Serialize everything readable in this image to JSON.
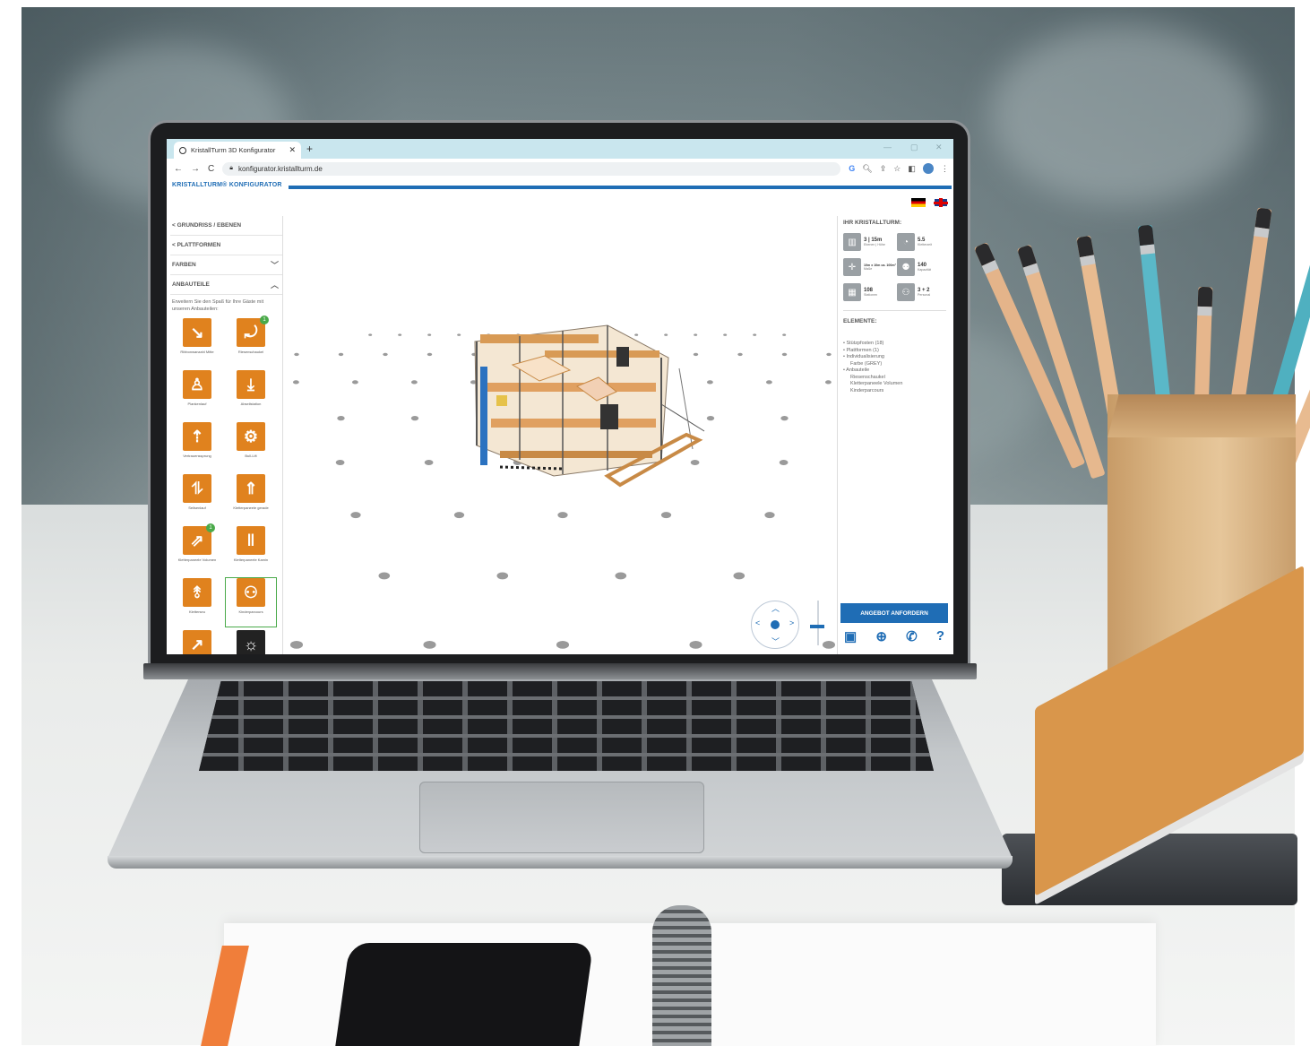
{
  "browser": {
    "tab_title": "KristallTurm 3D Konfigurator",
    "url": "konfigurator.kristallturm.de"
  },
  "app": {
    "brand": "KRISTALLTURM® KONFIGURATOR"
  },
  "sidebar": {
    "items": [
      {
        "label": "< GRUNDRISS / EBENEN"
      },
      {
        "label": "< PLATTFORMEN"
      },
      {
        "label": "FARBEN",
        "state": "collapsed"
      },
      {
        "label": "ANBAUTEILE",
        "state": "expanded"
      }
    ],
    "description": "Erweitern Sie den Spaß für Ihre Gäste mit unseren Anbauteilen:",
    "tiles": [
      {
        "label": "Ribbonwanzahl Mitte",
        "icon": "slide-figure-icon"
      },
      {
        "label": "Riesenschaukel",
        "icon": "swing-figure-icon",
        "badge": "1"
      },
      {
        "label": "Plankenlauf",
        "icon": "plank-walk-figure-icon"
      },
      {
        "label": "Abseilstation",
        "icon": "rappel-figure-icon"
      },
      {
        "label": "Vertrauenssprung",
        "icon": "trust-jump-figure-icon"
      },
      {
        "label": "Bull-Lift",
        "icon": "bike-figure-icon"
      },
      {
        "label": "Seilsenlauf",
        "icon": "rope-walk-figure-icon"
      },
      {
        "label": "Kletterpaneele gerade",
        "icon": "climbing-panel-icon"
      },
      {
        "label": "Kletterpaneele Volumen",
        "icon": "climbing-volume-icon",
        "badge": "1"
      },
      {
        "label": "Kletterpaneele Kamin",
        "icon": "climbing-chimney-icon"
      },
      {
        "label": "Kletterseu",
        "icon": "climbing-rope-icon"
      },
      {
        "label": "Kinderparcours",
        "icon": "kids-course-icon",
        "selected": true
      },
      {
        "label": "",
        "icon": "zipline-figure-icon"
      },
      {
        "label": "",
        "icon": "lightbulb-icon"
      }
    ]
  },
  "panel": {
    "title": "IHR KRISTALLTURM:",
    "stats": [
      {
        "value": "3 | 15m",
        "caption": "Ebenen | Höhe",
        "icon": "tower-levels-icon"
      },
      {
        "value": "5.5",
        "caption": "Kletterzeit",
        "icon": "clock-icon"
      },
      {
        "value": "10m x 10m ca. 100m²",
        "caption": "Maße",
        "icon": "area-icon"
      },
      {
        "value": "140",
        "caption": "Kapazität",
        "icon": "people-icon"
      },
      {
        "value": "108",
        "caption": "Stationen",
        "icon": "stations-icon"
      },
      {
        "value": "3 + 2",
        "caption": "Personal",
        "icon": "staff-icon"
      }
    ],
    "elements_title": "ELEMENTE:",
    "elements": [
      {
        "text": "Stützpfosten (18)"
      },
      {
        "text": "Plattformen (1)"
      },
      {
        "text": "Individualisierung",
        "sub": [
          "Farbe (GREY)"
        ]
      },
      {
        "text": "Anbauteile",
        "sub": [
          "Riesenschaukel",
          "Kletterpaneele Volumen",
          "Kinderparcours"
        ]
      }
    ],
    "cta_label": "ANGEBOT ANFORDERN",
    "action_icons": [
      "save-icon",
      "download-icon",
      "phone-icon",
      "help-icon"
    ]
  },
  "colors": {
    "accent": "#1f6db5",
    "tile": "#e0821e",
    "badge": "#4aaa4a"
  }
}
